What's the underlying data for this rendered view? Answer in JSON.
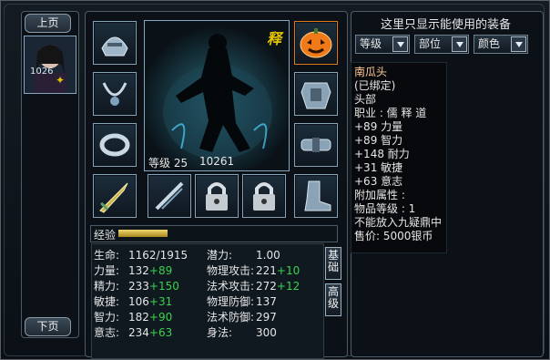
{
  "left": {
    "prev_label": "上页",
    "next_label": "下页",
    "char_number": "1026"
  },
  "center": {
    "level_label": "等级 25",
    "id_number": "10261",
    "badge_text": "释",
    "exp_label": "经验",
    "exp_progress": 0.23
  },
  "stats": {
    "rows_left": [
      {
        "label": "生命:",
        "value": "1162/1915",
        "bonus": ""
      },
      {
        "label": "力量:",
        "value": "132",
        "bonus": "+89"
      },
      {
        "label": "精力:",
        "value": "233",
        "bonus": "+150"
      },
      {
        "label": "敏捷:",
        "value": "106",
        "bonus": "+31"
      },
      {
        "label": "智力:",
        "value": "182",
        "bonus": "+90"
      },
      {
        "label": "意志:",
        "value": "234",
        "bonus": "+63"
      }
    ],
    "rows_right": [
      {
        "label": "潜力:",
        "value": "1.00",
        "bonus": ""
      },
      {
        "label": "物理攻击:",
        "value": "221",
        "bonus": "+10"
      },
      {
        "label": "法术攻击:",
        "value": "272",
        "bonus": "+12"
      },
      {
        "label": "物理防御:",
        "value": "137",
        "bonus": ""
      },
      {
        "label": "法术防御:",
        "value": "297",
        "bonus": ""
      },
      {
        "label": "身法:",
        "value": "300",
        "bonus": ""
      }
    ],
    "tab_basic": "基础",
    "tab_advanced": "高级"
  },
  "right": {
    "title": "这里只显示能使用的装备",
    "filters": [
      "等级",
      "部位",
      "颜色"
    ],
    "tooltip": {
      "name": "南瓜头",
      "bound": "(已绑定)",
      "slot": "头部",
      "job": "职业 : 儒 释 道",
      "attrs": [
        "+89 力量",
        "+89 智力",
        "+148 耐力",
        "+31 敏捷",
        "+63 意志"
      ],
      "extra_title": "附加属性 :",
      "item_level": "物品等级 : 1",
      "note": "不能放入九疑鼎中",
      "price": "售价: 5000银币"
    }
  },
  "colors": {
    "accent_gold": "#e4c400",
    "green_bonus": "#39d24d",
    "tooltip_name": "#ffcc99"
  }
}
